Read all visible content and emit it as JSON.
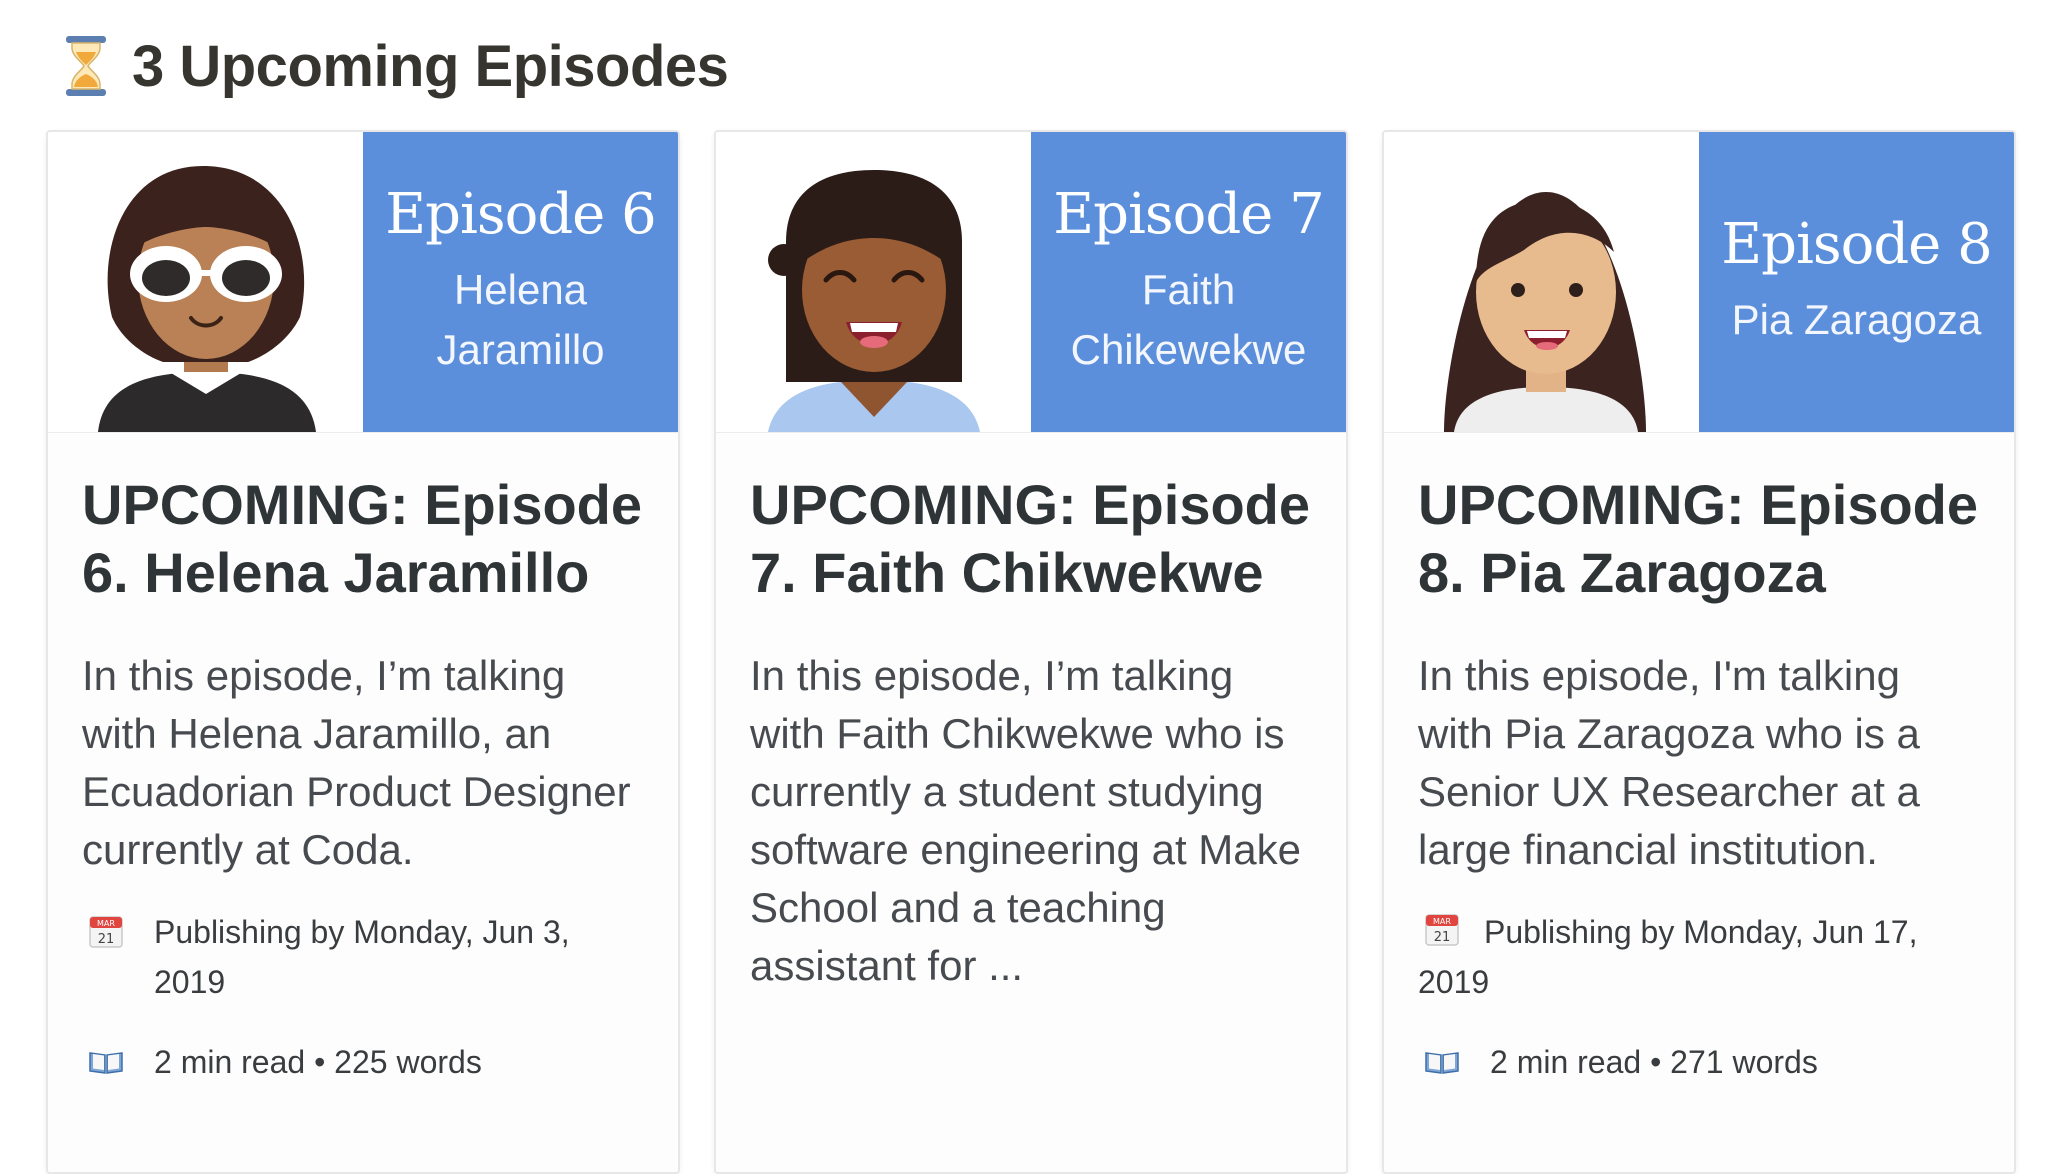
{
  "header": {
    "icon": "hourglass-icon",
    "title": "3 Upcoming Episodes"
  },
  "cards": [
    {
      "episode": "Episode 6",
      "guest_lines": [
        "Helena",
        "Jaramillo"
      ],
      "title": "UPCOMING: Episode 6. Helena Jaramillo",
      "description": "In this episode, I’m talking with Helena Jaramillo, an Ecuadorian Product Designer currently at Coda.",
      "publish": "Publishing by Monday, Jun 3, 2019",
      "read": "2 min read • 225 words",
      "calendar_icon": "calendar-icon",
      "book_icon": "book-icon"
    },
    {
      "episode": "Episode 7",
      "guest_lines": [
        "Faith",
        "Chikewekwe"
      ],
      "title": "UPCOMING: Episode 7. Faith Chikwekwe",
      "description": "In this episode, I’m talking with Faith Chikwekwe who is currently a student studying software engineering at Make School and a teaching assistant for ...",
      "calendar_icon": "calendar-icon"
    },
    {
      "episode": "Episode 8",
      "guest_lines": [
        "Pia Zaragoza"
      ],
      "title": "UPCOMING: Episode 8. Pia Zaragoza",
      "description": "In this episode, I'm talking with Pia Zaragoza who is a Senior UX Researcher at a large financial institution.",
      "publish": "Publishing by Monday, Jun 17, 2019",
      "read": "2 min read • 271 words",
      "calendar_icon": "calendar-icon",
      "book_icon": "book-icon"
    }
  ],
  "calendar_icon_text": {
    "month": "MAR",
    "day": "21"
  },
  "colors": {
    "cover_blue": "#5b8fdc",
    "title_text": "#2f3437"
  }
}
